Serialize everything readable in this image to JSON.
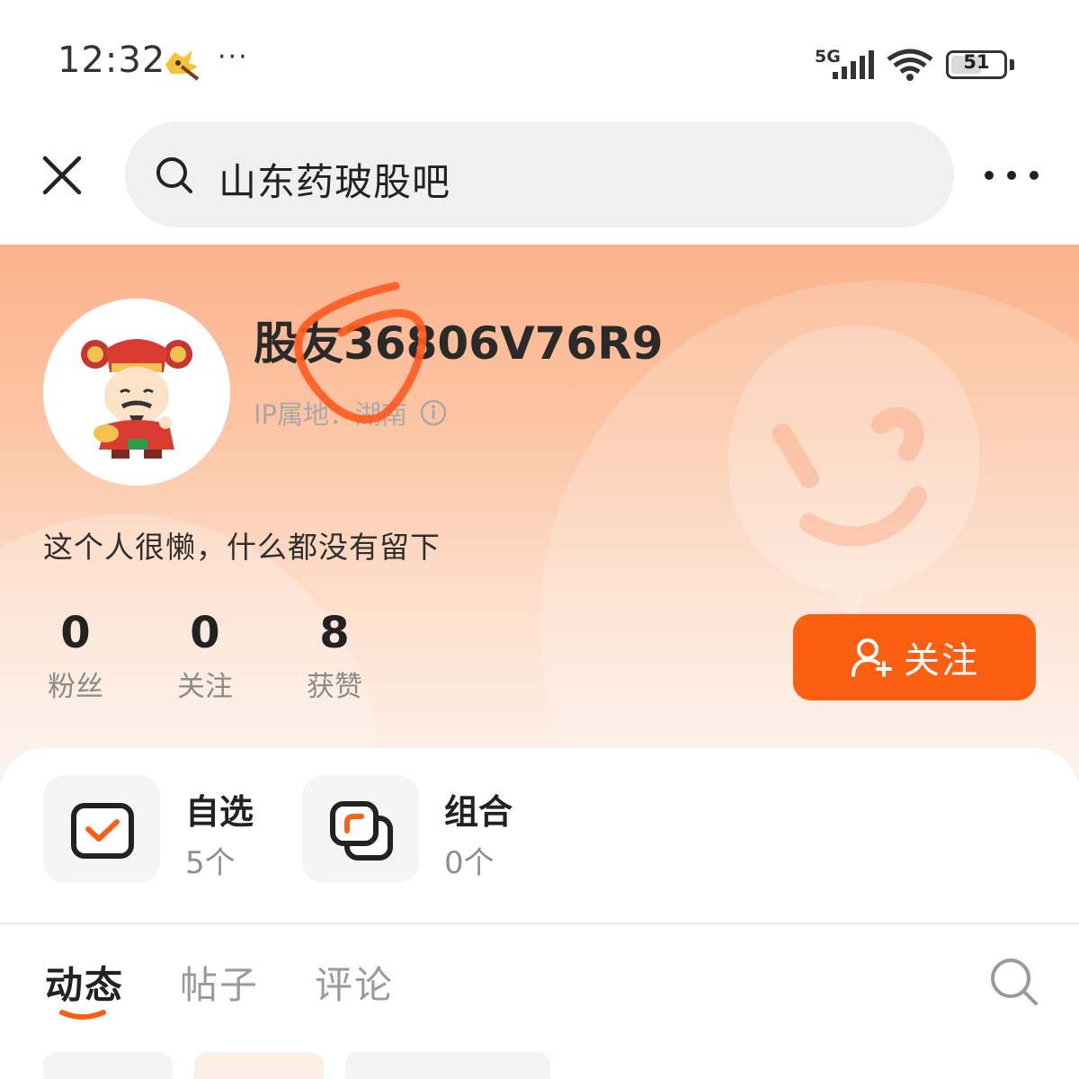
{
  "status_bar": {
    "time": "12:32",
    "overflow": "···",
    "network": "5G",
    "battery": "51"
  },
  "nav": {
    "search_text": "山东药玻股吧",
    "icons": [
      "close-icon",
      "search-icon",
      "more-icon"
    ]
  },
  "profile": {
    "username": "股友36806V76R9",
    "ip_location": "IP属地：湖南",
    "bio": "这个人很懒，什么都没有留下",
    "stats": [
      {
        "value": "0",
        "label": "粉丝"
      },
      {
        "value": "0",
        "label": "关注"
      },
      {
        "value": "8",
        "label": "获赞"
      }
    ],
    "follow_button": "关注"
  },
  "portfolio": {
    "watchlist": {
      "title": "自选",
      "count": "5个"
    },
    "combo": {
      "title": "组合",
      "count": "0个"
    }
  },
  "tabs": {
    "items": [
      {
        "label": "动态",
        "active": true
      },
      {
        "label": "帖子",
        "active": false
      },
      {
        "label": "评论",
        "active": false
      }
    ]
  },
  "colors": {
    "accent": "#fd5f12",
    "header_top": "#fbb28b",
    "scribble": "#ff5a1f"
  }
}
